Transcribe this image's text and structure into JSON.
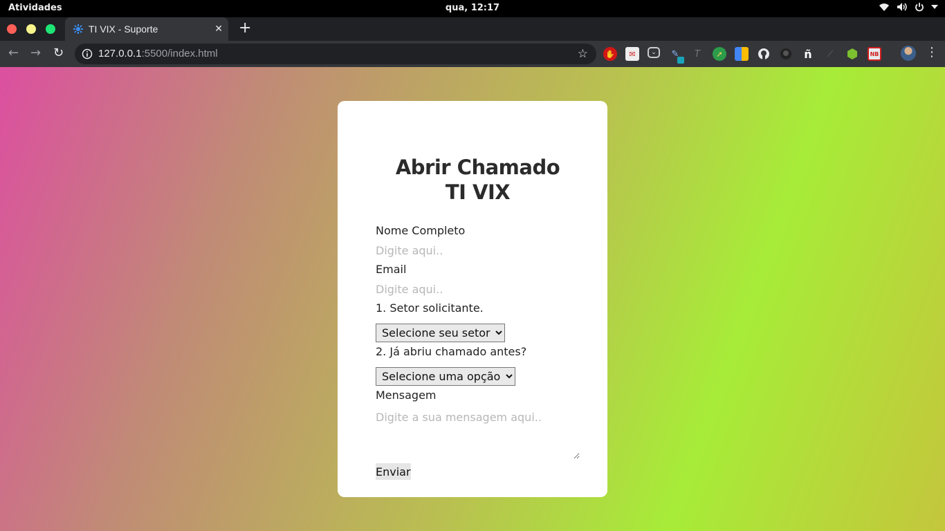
{
  "system": {
    "activities": "Atividades",
    "clock": "qua, 12:17"
  },
  "browser": {
    "tab_title": "TI VIX - Suporte",
    "url_host": "127.0.0.1",
    "url_rest": ":5500/index.html",
    "extensions": [
      "ublock-icon",
      "mail-icon",
      "pocket-icon",
      "pen-extension-icon",
      "font-extension-icon",
      "compass-icon",
      "grid-icon",
      "github-icon",
      "github-alt-icon",
      "enye-icon",
      "slash-icon",
      "node-icon",
      "nb-icon"
    ]
  },
  "form": {
    "title_line1": "Abrir Chamado",
    "title_line2": "TI VIX",
    "name_label": "Nome Completo",
    "name_placeholder": "Digite aqui..",
    "email_label": "Email",
    "email_placeholder": "Digite aqui..",
    "sector_label": "1. Setor solicitante.",
    "sector_selected": "Selecione seu setor",
    "previous_label": "2. Já abriu chamado antes?",
    "previous_selected": "Selecione uma opção",
    "message_label": "Mensagem",
    "message_placeholder": "Digite a sua mensagem aqui..",
    "submit_label": "Enviar"
  }
}
